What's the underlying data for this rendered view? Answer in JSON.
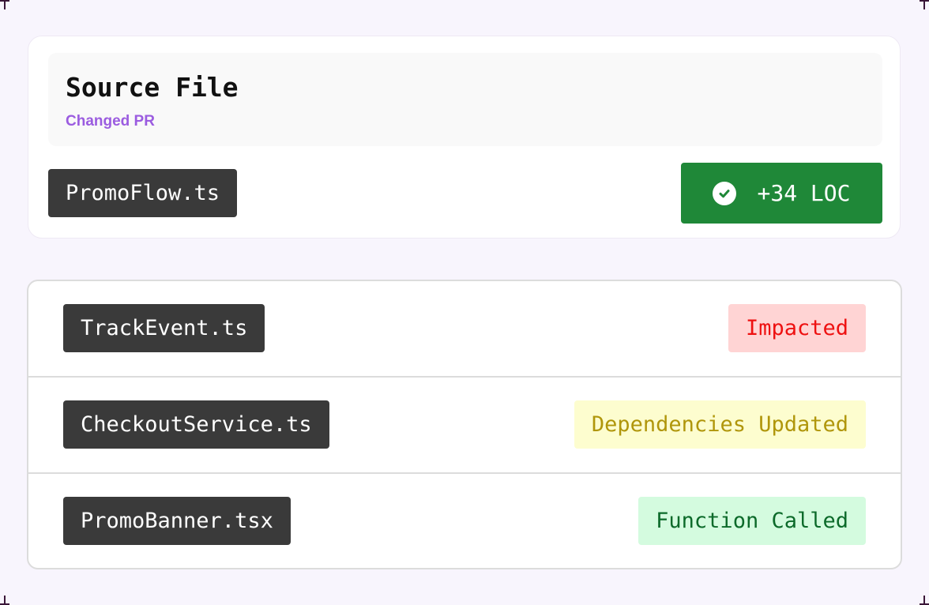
{
  "source": {
    "title": "Source File",
    "subtitle": "Changed PR",
    "file": "PromoFlow.ts",
    "loc": "+34 LOC",
    "loc_icon": "check-circle-icon",
    "loc_color": "#1f8838",
    "subtitle_color": "#9b5ce0"
  },
  "impacts": [
    {
      "file": "TrackEvent.ts",
      "status": "Impacted",
      "status_bg": "#ffd4d4",
      "status_fg": "#ee1111"
    },
    {
      "file": "CheckoutService.ts",
      "status": "Dependencies Updated",
      "status_bg": "#fdfdcf",
      "status_fg": "#b0960b"
    },
    {
      "file": "PromoBanner.tsx",
      "status": "Function Called",
      "status_bg": "#d4fbdf",
      "status_fg": "#0c6a2a"
    }
  ]
}
